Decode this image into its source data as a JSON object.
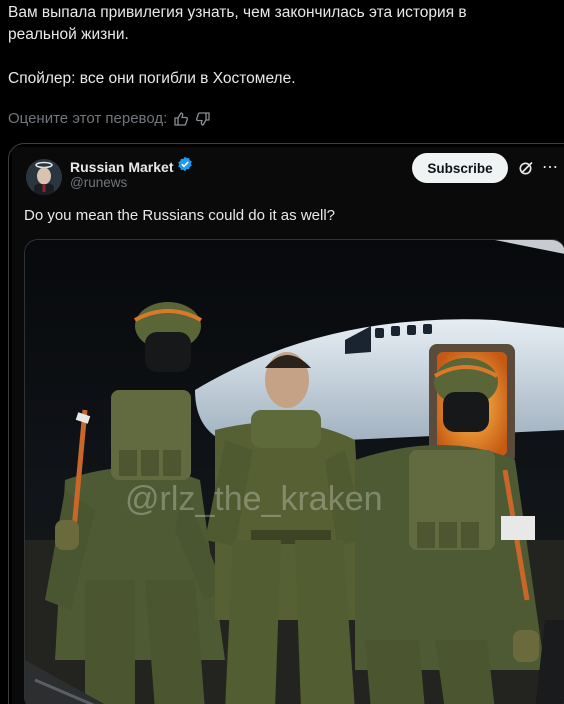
{
  "post": {
    "line1": "Вам выпала привилегия узнать, чем закончилась эта история в",
    "line2": "реальной жизни.",
    "line3": "Спойлер: все они погибли в Хостомеле."
  },
  "rate_translation": {
    "label": "Оцените этот перевод:",
    "thumbs_up_icon": "thumbs-up-icon",
    "thumbs_down_icon": "thumbs-down-icon"
  },
  "quoted_tweet": {
    "display_name": "Russian Market",
    "handle": "@runews",
    "verified_icon": "verified-badge-icon",
    "subscribe_label": "Subscribe",
    "text": "Do you mean the Russians could do it as well?",
    "grok_icon": "grok-icon",
    "more_icon": "more-dots-icon",
    "media_watermark": "@rlz_the_kraken"
  },
  "colors": {
    "background": "#000000",
    "text": "#e7e9ea",
    "muted": "#71767b",
    "verified": "#1d9bf0",
    "subscribe_bg": "#eff3f4"
  }
}
